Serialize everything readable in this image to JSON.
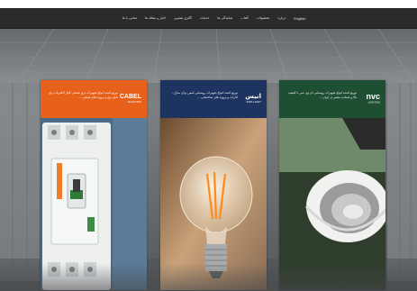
{
  "nav": {
    "items": [
      {
        "key": "lang",
        "label": "English"
      },
      {
        "key": "home",
        "label": "درباره"
      },
      {
        "key": "products",
        "label": "محصولات"
      },
      {
        "key": "brands",
        "label": "آفتاب"
      },
      {
        "key": "projects",
        "label": "نمایندگی ها"
      },
      {
        "key": "services",
        "label": "خدمات"
      },
      {
        "key": "gallery",
        "label": "گالری تصاویر"
      },
      {
        "key": "news",
        "label": "اخبار و مقاله ها"
      },
      {
        "key": "contact",
        "label": "تماس با ما"
      }
    ]
  },
  "cards": [
    {
      "brand": "nvc",
      "logo_text": "nvc",
      "logo_sub": "LIGHTING",
      "header_color": "#1e4f33",
      "description": "توزیع کننده انواع تجهیزات روشنایی ان وی سی با کیفیت بالا و ضمانت معتبر در ایران ..."
    },
    {
      "brand": "anis",
      "logo_text": "انیس",
      "logo_sub": "ANIS LIGHT",
      "header_color": "#1d3460",
      "description": "توزیع کننده انواع تجهیزات روشنایی انیس برای منازل، ادارات و پروژه های ساختمانی ..."
    },
    {
      "brand": "cabel",
      "logo_text": "CABEL",
      "logo_sub": "ELECTRIC",
      "header_color": "#e8611b",
      "description": "توزیع کننده انواع تجهیزات برق صنعتی کابل الکتریک برای تابلو برق و پروژه های صنعتی ..."
    }
  ],
  "colors": {
    "nav_bg": "#2b2b2d",
    "nav_text": "#e2e2e2",
    "nvc_header": "#1e4f33",
    "anis_header": "#1d3460",
    "cabel_header": "#e8611b"
  }
}
